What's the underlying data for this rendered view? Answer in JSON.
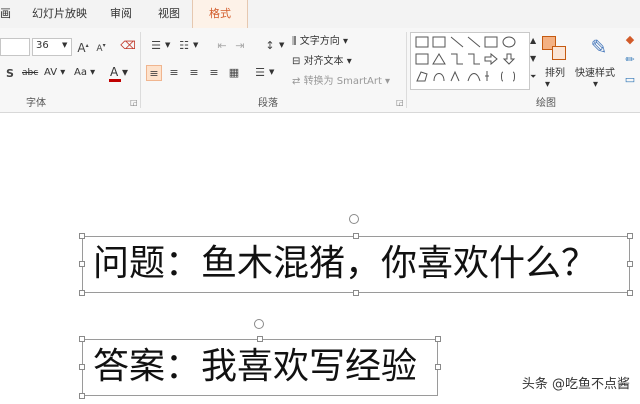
{
  "tabs": [
    {
      "label": "画"
    },
    {
      "label": "幻灯片放映"
    },
    {
      "label": "审阅"
    },
    {
      "label": "视图"
    },
    {
      "label": "格式"
    }
  ],
  "font_group": {
    "label": "字体",
    "font_size": "36",
    "text_shadow_label": "S",
    "strike_label": "abc",
    "spacing_label": "AV",
    "case_label": "Aa",
    "font_color_label": "A",
    "font_color": "#c00000",
    "grow_label": "A",
    "shrink_label": "A"
  },
  "paragraph_group": {
    "label": "段落",
    "text_direction": "文字方向",
    "align_text": "对齐文本",
    "convert_smartart": "转换为 SmartArt"
  },
  "drawing_group": {
    "label": "绘图",
    "arrange": "排列",
    "quick_styles": "快速样式"
  },
  "slide": {
    "question": "问题：鱼木混猪，你喜欢什么？",
    "answer": "答案：我喜欢写经验"
  },
  "watermark": "头条 @吃鱼不点酱",
  "colors": {
    "accent": "#d25b2a",
    "selection": "#fde2cc"
  }
}
